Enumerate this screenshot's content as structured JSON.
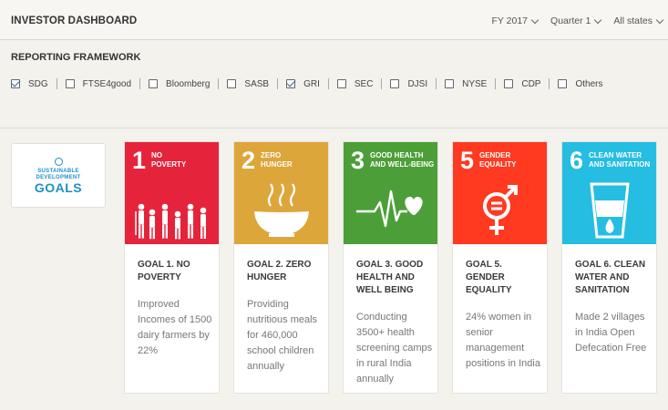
{
  "header": {
    "title": "INVESTOR DASHBOARD",
    "filters": [
      {
        "label": "FY 2017"
      },
      {
        "label": "Quarter 1"
      },
      {
        "label": "All states"
      }
    ]
  },
  "framework": {
    "title": "REPORTING FRAMEWORK",
    "items": [
      {
        "label": "SDG",
        "checked": true
      },
      {
        "label": "FTSE4good",
        "checked": false
      },
      {
        "label": "Bloomberg",
        "checked": false
      },
      {
        "label": "SASB",
        "checked": false
      },
      {
        "label": "GRI",
        "checked": true
      },
      {
        "label": "SEC",
        "checked": false
      },
      {
        "label": "DJSI",
        "checked": false
      },
      {
        "label": "NYSE",
        "checked": false
      },
      {
        "label": "CDP",
        "checked": false
      },
      {
        "label": "Others",
        "checked": false
      }
    ]
  },
  "logo": {
    "line1": "SUSTAINABLE",
    "line2": "DEVELOPMENT",
    "line3": "GOALS"
  },
  "goals": [
    {
      "number": "1",
      "tile_name": "NO\nPOVERTY",
      "title": "GOAL 1. NO POVERTY",
      "desc": "Improved Incomes of 1500 dairy farmers by 22%",
      "color": "#e5243b",
      "icon": "family-icon"
    },
    {
      "number": "2",
      "tile_name": "ZERO\nHUNGER",
      "title": "GOAL 2. ZERO HUNGER",
      "desc": "Providing nutritious meals for 460,000 school children annually",
      "color": "#dda63a",
      "icon": "bowl-icon"
    },
    {
      "number": "3",
      "tile_name": "GOOD HEALTH\nAND WELL-BEING",
      "title": "GOAL 3. GOOD HEALTH AND WELL BEING",
      "desc": "Conducting 3500+ health screening camps in rural India annually",
      "color": "#4c9f38",
      "icon": "heartbeat-icon"
    },
    {
      "number": "5",
      "tile_name": "GENDER\nEQUALITY",
      "title": "GOAL 5. GENDER EQUALITY",
      "desc": "24% women in senior management positions in India",
      "color": "#ff3a21",
      "icon": "gender-equality-icon"
    },
    {
      "number": "6",
      "tile_name": "CLEAN WATER\nAND SANITATION",
      "title": "GOAL 6. CLEAN WATER AND SANITATION",
      "desc": "Made 2 villages in India Open Defecation Free",
      "color": "#26bde2",
      "icon": "water-glass-icon"
    }
  ]
}
